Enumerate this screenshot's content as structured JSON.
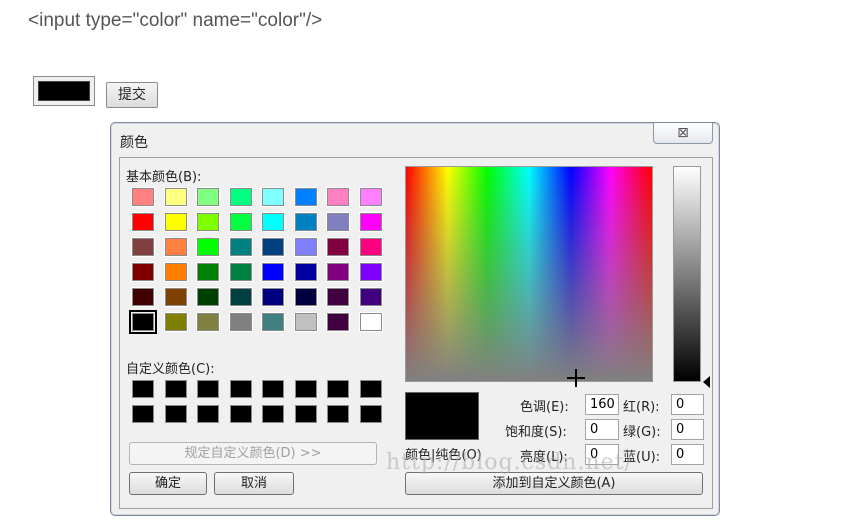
{
  "page": {
    "code_snippet": "<input type=\"color\" name=\"color\"/>",
    "submit_label": "提交",
    "color_value": "#000000"
  },
  "dialog": {
    "title": "颜色",
    "close_glyph": "⊠",
    "basic_colors_label": "基本颜色(B):",
    "basic_colors": [
      "#ff8080",
      "#ffff80",
      "#80ff80",
      "#00ff80",
      "#80ffff",
      "#0080ff",
      "#ff80c0",
      "#ff80ff",
      "#ff0000",
      "#ffff00",
      "#80ff00",
      "#00ff40",
      "#00ffff",
      "#0080c0",
      "#8080c0",
      "#ff00ff",
      "#804040",
      "#ff8040",
      "#00ff00",
      "#008080",
      "#004080",
      "#8080ff",
      "#800040",
      "#ff0080",
      "#800000",
      "#ff8000",
      "#008000",
      "#008040",
      "#0000ff",
      "#0000a0",
      "#800080",
      "#8000ff",
      "#400000",
      "#804000",
      "#004000",
      "#004040",
      "#000080",
      "#000040",
      "#400040",
      "#400080",
      "#000000",
      "#808000",
      "#808040",
      "#808080",
      "#408080",
      "#c0c0c0",
      "#400040",
      "#ffffff"
    ],
    "custom_colors_label": "自定义颜色(C):",
    "custom_colors": [
      "#000000",
      "#000000",
      "#000000",
      "#000000",
      "#000000",
      "#000000",
      "#000000",
      "#000000",
      "#000000",
      "#000000",
      "#000000",
      "#000000",
      "#000000",
      "#000000",
      "#000000",
      "#000000"
    ],
    "define_custom_button": "规定自定义颜色(D) >>",
    "ok_button": "确定",
    "cancel_button": "取消",
    "color_solid_label": "颜色|纯色(O)",
    "hue_label": "色调(E):",
    "hue_value": "160",
    "sat_label": "饱和度(S):",
    "sat_value": "0",
    "lum_label": "亮度(L):",
    "lum_value": "0",
    "red_label": "红(R):",
    "red_value": "0",
    "green_label": "绿(G):",
    "green_value": "0",
    "blue_label": "蓝(U):",
    "blue_value": "0",
    "add_custom_button": "添加到自定义颜色(A)",
    "watermark": "http://blog.csdn.net/"
  }
}
